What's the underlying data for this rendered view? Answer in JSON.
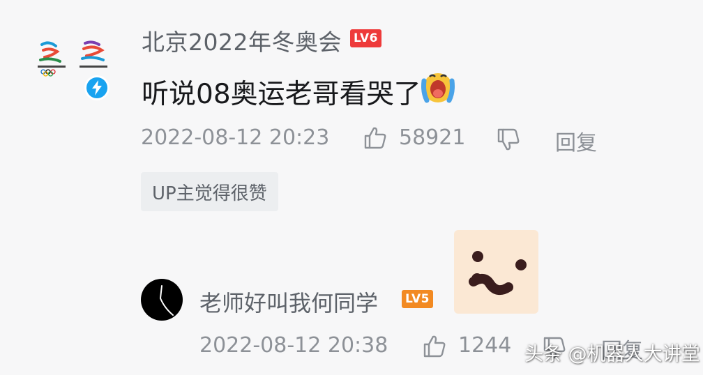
{
  "post": {
    "username": "北京2022年冬奥会",
    "level_badge": "LV6",
    "comment": "听说08奥运老哥看哭了",
    "timestamp": "2022-08-12 20:23",
    "like_count": "58921",
    "reply_label": "回复",
    "up_tag": "UP主觉得很赞",
    "colors": {
      "badge": "#ee3a3a",
      "verified": "#19a3f0"
    },
    "icons": [
      "beijing-2022-emblem-icon",
      "verified-lightning-icon",
      "crying-emoji-icon",
      "thumb-up-icon",
      "thumb-down-icon"
    ]
  },
  "reply": {
    "username": "老师好叫我何同学",
    "level_badge": "LV5",
    "timestamp": "2022-08-12 20:38",
    "like_count": "1244",
    "reply_label": "回复",
    "colors": {
      "badge": "#f28a22"
    },
    "icons": [
      "sticker-face-icon",
      "thumb-up-icon",
      "thumb-down-icon"
    ]
  },
  "watermark": "头条 @机器人大讲堂"
}
